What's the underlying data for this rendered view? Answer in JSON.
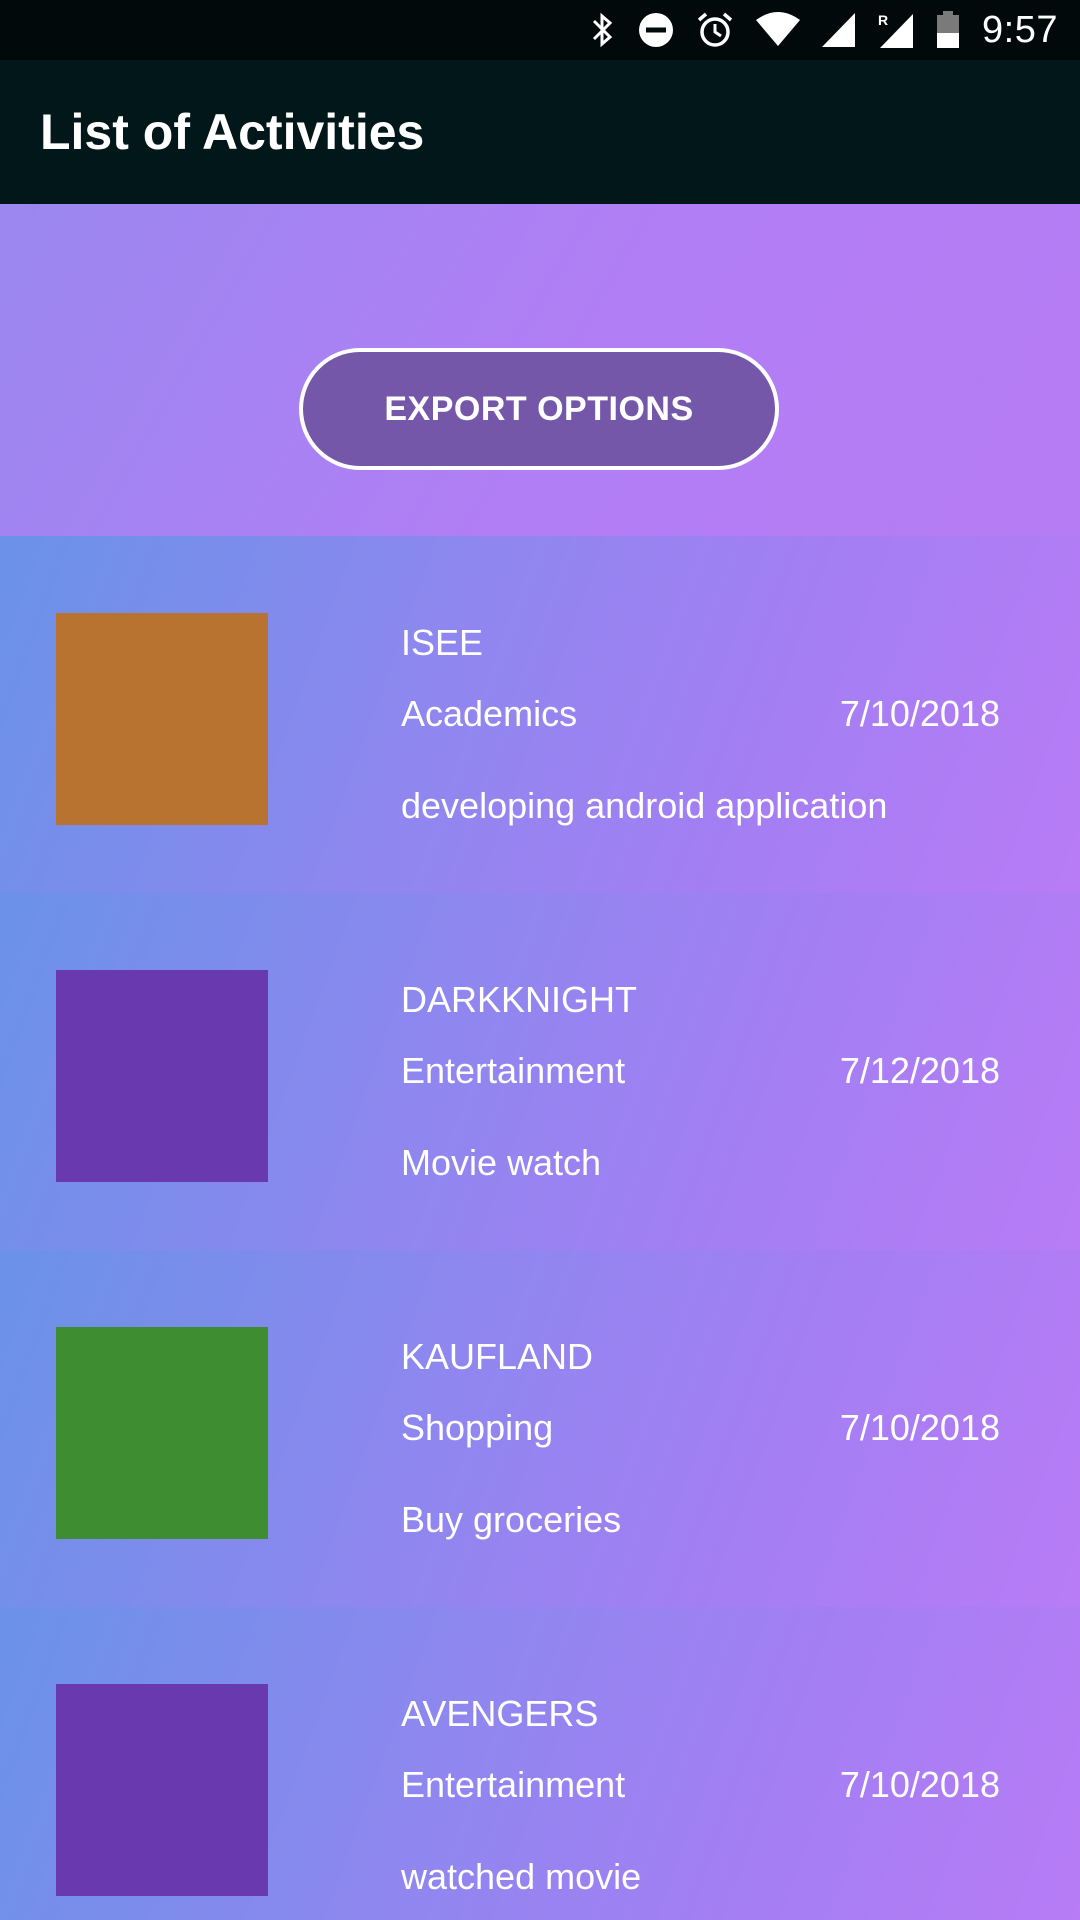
{
  "status_bar": {
    "time": "9:57",
    "icons": [
      "bluetooth-icon",
      "do-not-disturb-icon",
      "alarm-icon",
      "wifi-icon",
      "signal-icon",
      "roaming-signal-icon",
      "battery-icon"
    ]
  },
  "app_bar": {
    "title": "List of Activities"
  },
  "export": {
    "label": "EXPORT OPTIONS"
  },
  "activities": [
    {
      "name": "ISEE",
      "category": "Academics",
      "date": "7/10/2018",
      "description": "developing android application",
      "color": "#b97331"
    },
    {
      "name": "DARKKNIGHT",
      "category": "Entertainment",
      "date": "7/12/2018",
      "description": "Movie watch",
      "color": "#6939b0"
    },
    {
      "name": "KAUFLAND",
      "category": "Shopping",
      "date": "7/10/2018",
      "description": "Buy groceries",
      "color": "#3e8e31"
    },
    {
      "name": "AVENGERS",
      "category": "Entertainment",
      "date": "7/10/2018",
      "description": "watched movie",
      "color": "#6939b0"
    }
  ],
  "colors": {
    "status_bar": "#01090b",
    "app_bar": "#011719",
    "export_button": "#7457a9"
  }
}
